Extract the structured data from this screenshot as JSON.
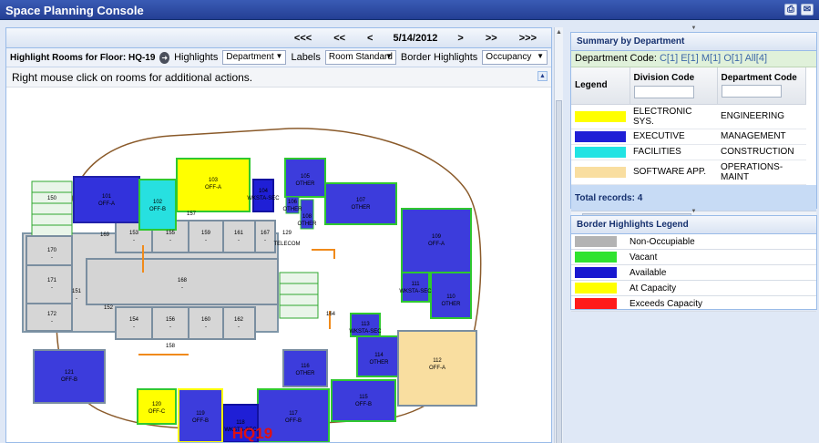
{
  "app": {
    "title": "Space Planning Console"
  },
  "nav": {
    "first": "<<<",
    "prev2": "<<",
    "prev": "<",
    "date": "5/14/2012",
    "next": ">",
    "next2": ">>",
    "last": ">>>"
  },
  "toolbar": {
    "floor_label": "Highlight Rooms for Floor: HQ-19",
    "highlights_label": "Highlights",
    "highlights_value": "Department",
    "labels_label": "Labels",
    "labels_value": "Room Standard",
    "border_label": "Border Highlights",
    "border_value": "Occupancy"
  },
  "info": {
    "text": "Right mouse click on rooms for additional actions."
  },
  "summary": {
    "title": "Summary by Department",
    "dept_code_label": "Department Code:",
    "codes": [
      "C[1]",
      "E[1]",
      "M[1]",
      "O[1]",
      "All[4]"
    ],
    "columns": [
      "Legend",
      "Division Code",
      "Department Code"
    ],
    "rows": [
      {
        "color": "#ffff00",
        "division": "ELECTRONIC SYS.",
        "department": "ENGINEERING"
      },
      {
        "color": "#1f1fd6",
        "division": "EXECUTIVE",
        "department": "MANAGEMENT"
      },
      {
        "color": "#21e3e3",
        "division": "FACILITIES",
        "department": "CONSTRUCTION"
      },
      {
        "color": "#f9dea0",
        "division": "SOFTWARE APP.",
        "department": "OPERATIONS-MAINT"
      }
    ],
    "total": "Total records: 4"
  },
  "border_legend": {
    "title": "Border Highlights Legend",
    "items": [
      {
        "color": "#b3b3b3",
        "label": "Non-Occupiable"
      },
      {
        "color": "#2fe32f",
        "label": "Vacant"
      },
      {
        "color": "#1818d0",
        "label": "Available"
      },
      {
        "color": "#ffff00",
        "label": "At Capacity"
      },
      {
        "color": "#ff1a1a",
        "label": "Exceeds Capacity"
      }
    ]
  },
  "floorplan": {
    "floor_name": "HQ19",
    "rooms": [
      {
        "id": "101",
        "type": "OFF-A"
      },
      {
        "id": "102",
        "type": "OFF-B"
      },
      {
        "id": "103",
        "type": "OFF-A"
      },
      {
        "id": "104",
        "type": "WKSTA-SEC"
      },
      {
        "id": "105",
        "type": "OTHER"
      },
      {
        "id": "106",
        "type": "OTHER"
      },
      {
        "id": "108",
        "type": "OTHER"
      },
      {
        "id": "107",
        "type": "OTHER"
      },
      {
        "id": "109",
        "type": "OFF-A"
      },
      {
        "id": "110",
        "type": "OTHER"
      },
      {
        "id": "111",
        "type": "WKSTA-SEC"
      },
      {
        "id": "112",
        "type": "OFF-A"
      },
      {
        "id": "113",
        "type": "WKSTA-SEC"
      },
      {
        "id": "114",
        "type": "OTHER"
      },
      {
        "id": "115",
        "type": "OFF-B"
      },
      {
        "id": "116",
        "type": "OTHER"
      },
      {
        "id": "117",
        "type": "OFF-B"
      },
      {
        "id": "118",
        "type": "WKSTA-SEC"
      },
      {
        "id": "119",
        "type": "OFF-B"
      },
      {
        "id": "120",
        "type": "OFF-C"
      },
      {
        "id": "121",
        "type": "OFF-B"
      },
      {
        "id": "168",
        "type": "-"
      },
      {
        "id": "150",
        "type": ""
      },
      {
        "id": "170",
        "type": "-"
      },
      {
        "id": "171",
        "type": "-"
      },
      {
        "id": "172",
        "type": "-"
      },
      {
        "id": "151",
        "type": "-"
      },
      {
        "id": "153",
        "type": "-"
      },
      {
        "id": "155",
        "type": "-"
      },
      {
        "id": "159",
        "type": "-"
      },
      {
        "id": "161",
        "type": "-"
      },
      {
        "id": "167",
        "type": "-"
      },
      {
        "id": "129",
        "type": "TELECOM"
      },
      {
        "id": "169",
        "type": ""
      },
      {
        "id": "157",
        "type": ""
      },
      {
        "id": "152",
        "type": ""
      },
      {
        "id": "154",
        "type": "-"
      },
      {
        "id": "156",
        "type": "-"
      },
      {
        "id": "160",
        "type": "-"
      },
      {
        "id": "162",
        "type": "-"
      },
      {
        "id": "158",
        "type": ""
      },
      {
        "id": "164",
        "type": ""
      }
    ]
  }
}
